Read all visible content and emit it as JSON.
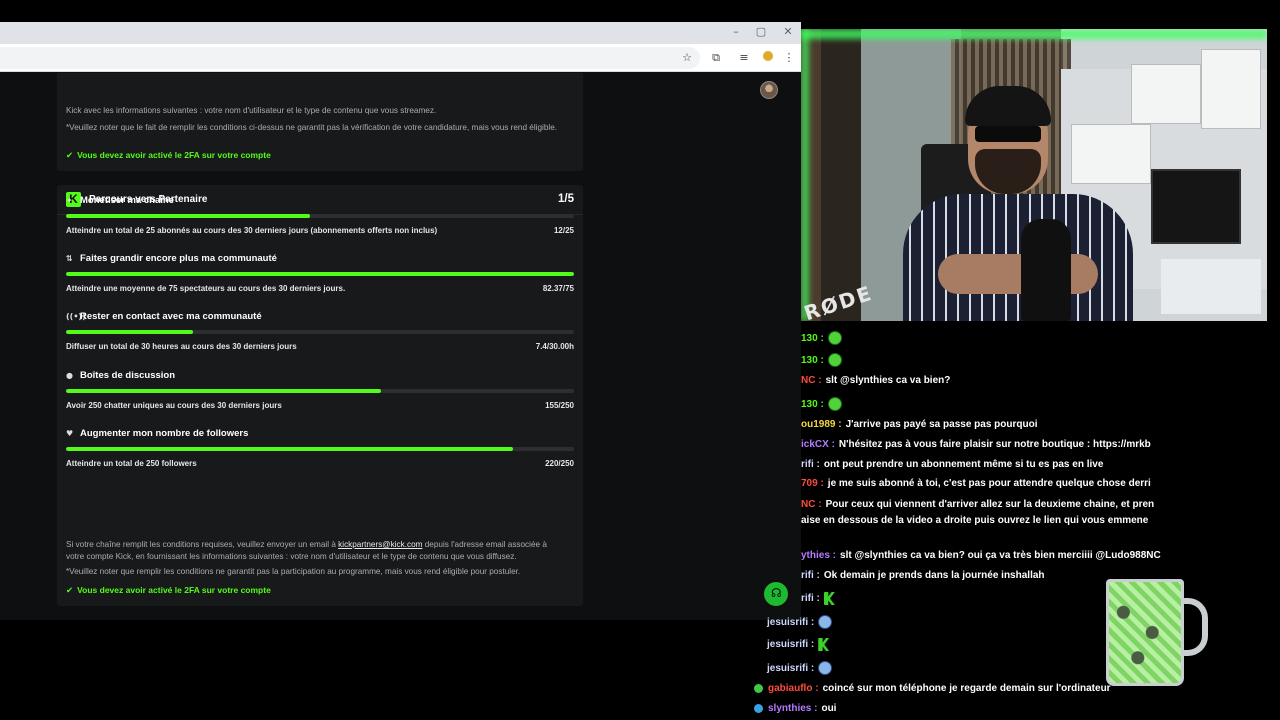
{
  "browser": {
    "window_controls": [
      "–",
      "▢",
      "✕"
    ],
    "top_card": {
      "partial_text": "Kick avec les informations suivantes : votre nom d'utilisateur et le type de contenu que vous streamez.",
      "note": "*Veuillez noter que le fait de remplir les conditions ci-dessus ne garantit pas la vérification de votre candidature, mais vous rend éligible.",
      "check": "Vous devez avoir activé le 2FA sur votre compte"
    },
    "partner_card": {
      "logo": "K",
      "title": "Parcours vers Partenaire",
      "step": "1/5",
      "goals": [
        {
          "icon": "sparkle-icon",
          "glyph": "✦",
          "title": "Monétiser ma chaîne",
          "desc": "Atteindre un total de 25 abonnés au cours des 30 derniers jours (abonnements offerts non inclus)",
          "value": "12/25",
          "progress": 0.48
        },
        {
          "icon": "growth-icon",
          "glyph": "⇅",
          "title": "Faites grandir encore plus ma communauté",
          "desc": "Atteindre une moyenne de 75 spectateurs au cours des 30 derniers jours.",
          "value": "82.37/75",
          "progress": 1.0
        },
        {
          "icon": "broadcast-icon",
          "glyph": "((•))",
          "title": "Rester en contact avec ma communauté",
          "desc": "Diffuser un total de 30 heures au cours des 30 derniers jours",
          "value": "7.4/30.00h",
          "progress": 0.25
        },
        {
          "icon": "chat-bubble-icon",
          "glyph": "●",
          "title": "Boîtes de discussion",
          "desc": "Avoir 250 chatter uniques au cours des 30 derniers jours",
          "value": "155/250",
          "progress": 0.62
        },
        {
          "icon": "heart-icon",
          "glyph": "♥",
          "title": "Augmenter mon nombre de followers",
          "desc": "Atteindre un total de 250 followers",
          "value": "220/250",
          "progress": 0.88
        }
      ],
      "footer_text_1": "Si votre chaîne remplit les conditions requises, veuillez envoyer un email à",
      "footer_email": "kickpartners@kick.com",
      "footer_text_2": "depuis l'adresse email associée à votre compte Kick, en fournissant les informations suivantes : votre nom d'utilisateur et le type de contenu que vous diffusez.",
      "footer_note": "*Veuillez noter que remplir les conditions ne garantit pas la participation au programme, mais vous rend éligible pour postuler.",
      "footer_check": "Vous devez avoir activé le 2FA sur votre compte"
    }
  },
  "webcam": {
    "mic_brand": "RØDE"
  },
  "chat": {
    "messages": [
      {
        "user": "130 :",
        "text": "",
        "emote": "green",
        "color": "#53fc18"
      },
      {
        "user": "130 :",
        "text": "",
        "emote": "green",
        "color": "#53fc18"
      },
      {
        "user": "NC :",
        "text": "slt @slynthies ca va bien?",
        "emote": "",
        "color": "#ff4b3e"
      },
      {
        "user": "130 :",
        "text": "",
        "emote": "green",
        "color": "#53fc18"
      },
      {
        "user": "ou1989 :",
        "text": "J'arrive pas payé sa passe pas pourquoi",
        "emote": "",
        "color": "#f5d742"
      },
      {
        "user": "ickCX :",
        "text": "N'hésitez pas à vous faire plaisir sur notre boutique : https://mrkb",
        "emote": "",
        "color": "#b57bff"
      },
      {
        "user": "rifi :",
        "text": "ont peut prendre un abonnement même si tu es pas en live",
        "emote": "",
        "color": "#cfd8ff"
      },
      {
        "user": "709 :",
        "text": "je me suis abonné à toi, c'est pas pour attendre quelque chose derri",
        "emote": "",
        "color": "#ff4b3e"
      },
      {
        "user": "NC :",
        "text": "Pour ceux qui viennent d'arriver allez sur la deuxieme chaine, et pren",
        "emote": "",
        "color": "#ff4b3e"
      },
      {
        "user": "",
        "text": "aise en dessous de la video a droite puis ouvrez le lien qui vous emmene",
        "emote": "",
        "color": "#ffffff"
      },
      {
        "user": "ythies :",
        "text": "slt @slynthies ca va bien? oui ça va très bien merciiii @Ludo988NC",
        "emote": "",
        "color": "#b57bff"
      },
      {
        "user": "rifi :",
        "text": "Ok demain je prends dans la journée inshallah",
        "emote": "",
        "color": "#cfd8ff"
      },
      {
        "user": "rifi :",
        "text": "",
        "emote": "k",
        "color": "#cfd8ff"
      },
      {
        "user": "jesuisrifi :",
        "text": "",
        "emote": "blue",
        "color": "#cfd8ff"
      },
      {
        "user": "jesuisrifi :",
        "text": "",
        "emote": "k",
        "color": "#cfd8ff"
      },
      {
        "user": "jesuisrifi :",
        "text": "",
        "emote": "blue",
        "color": "#cfd8ff"
      },
      {
        "user": "gabiauflo :",
        "text": "coincé sur mon téléphone je regarde demain sur l'ordinateur",
        "emote": "",
        "color": "#ff4b3e"
      },
      {
        "user": "slynthies :",
        "text": "oui",
        "emote": "",
        "color": "#b57bff"
      }
    ]
  },
  "colors": {
    "accent": "#53fc18",
    "card": "#18191b",
    "page": "#0e0f10"
  }
}
